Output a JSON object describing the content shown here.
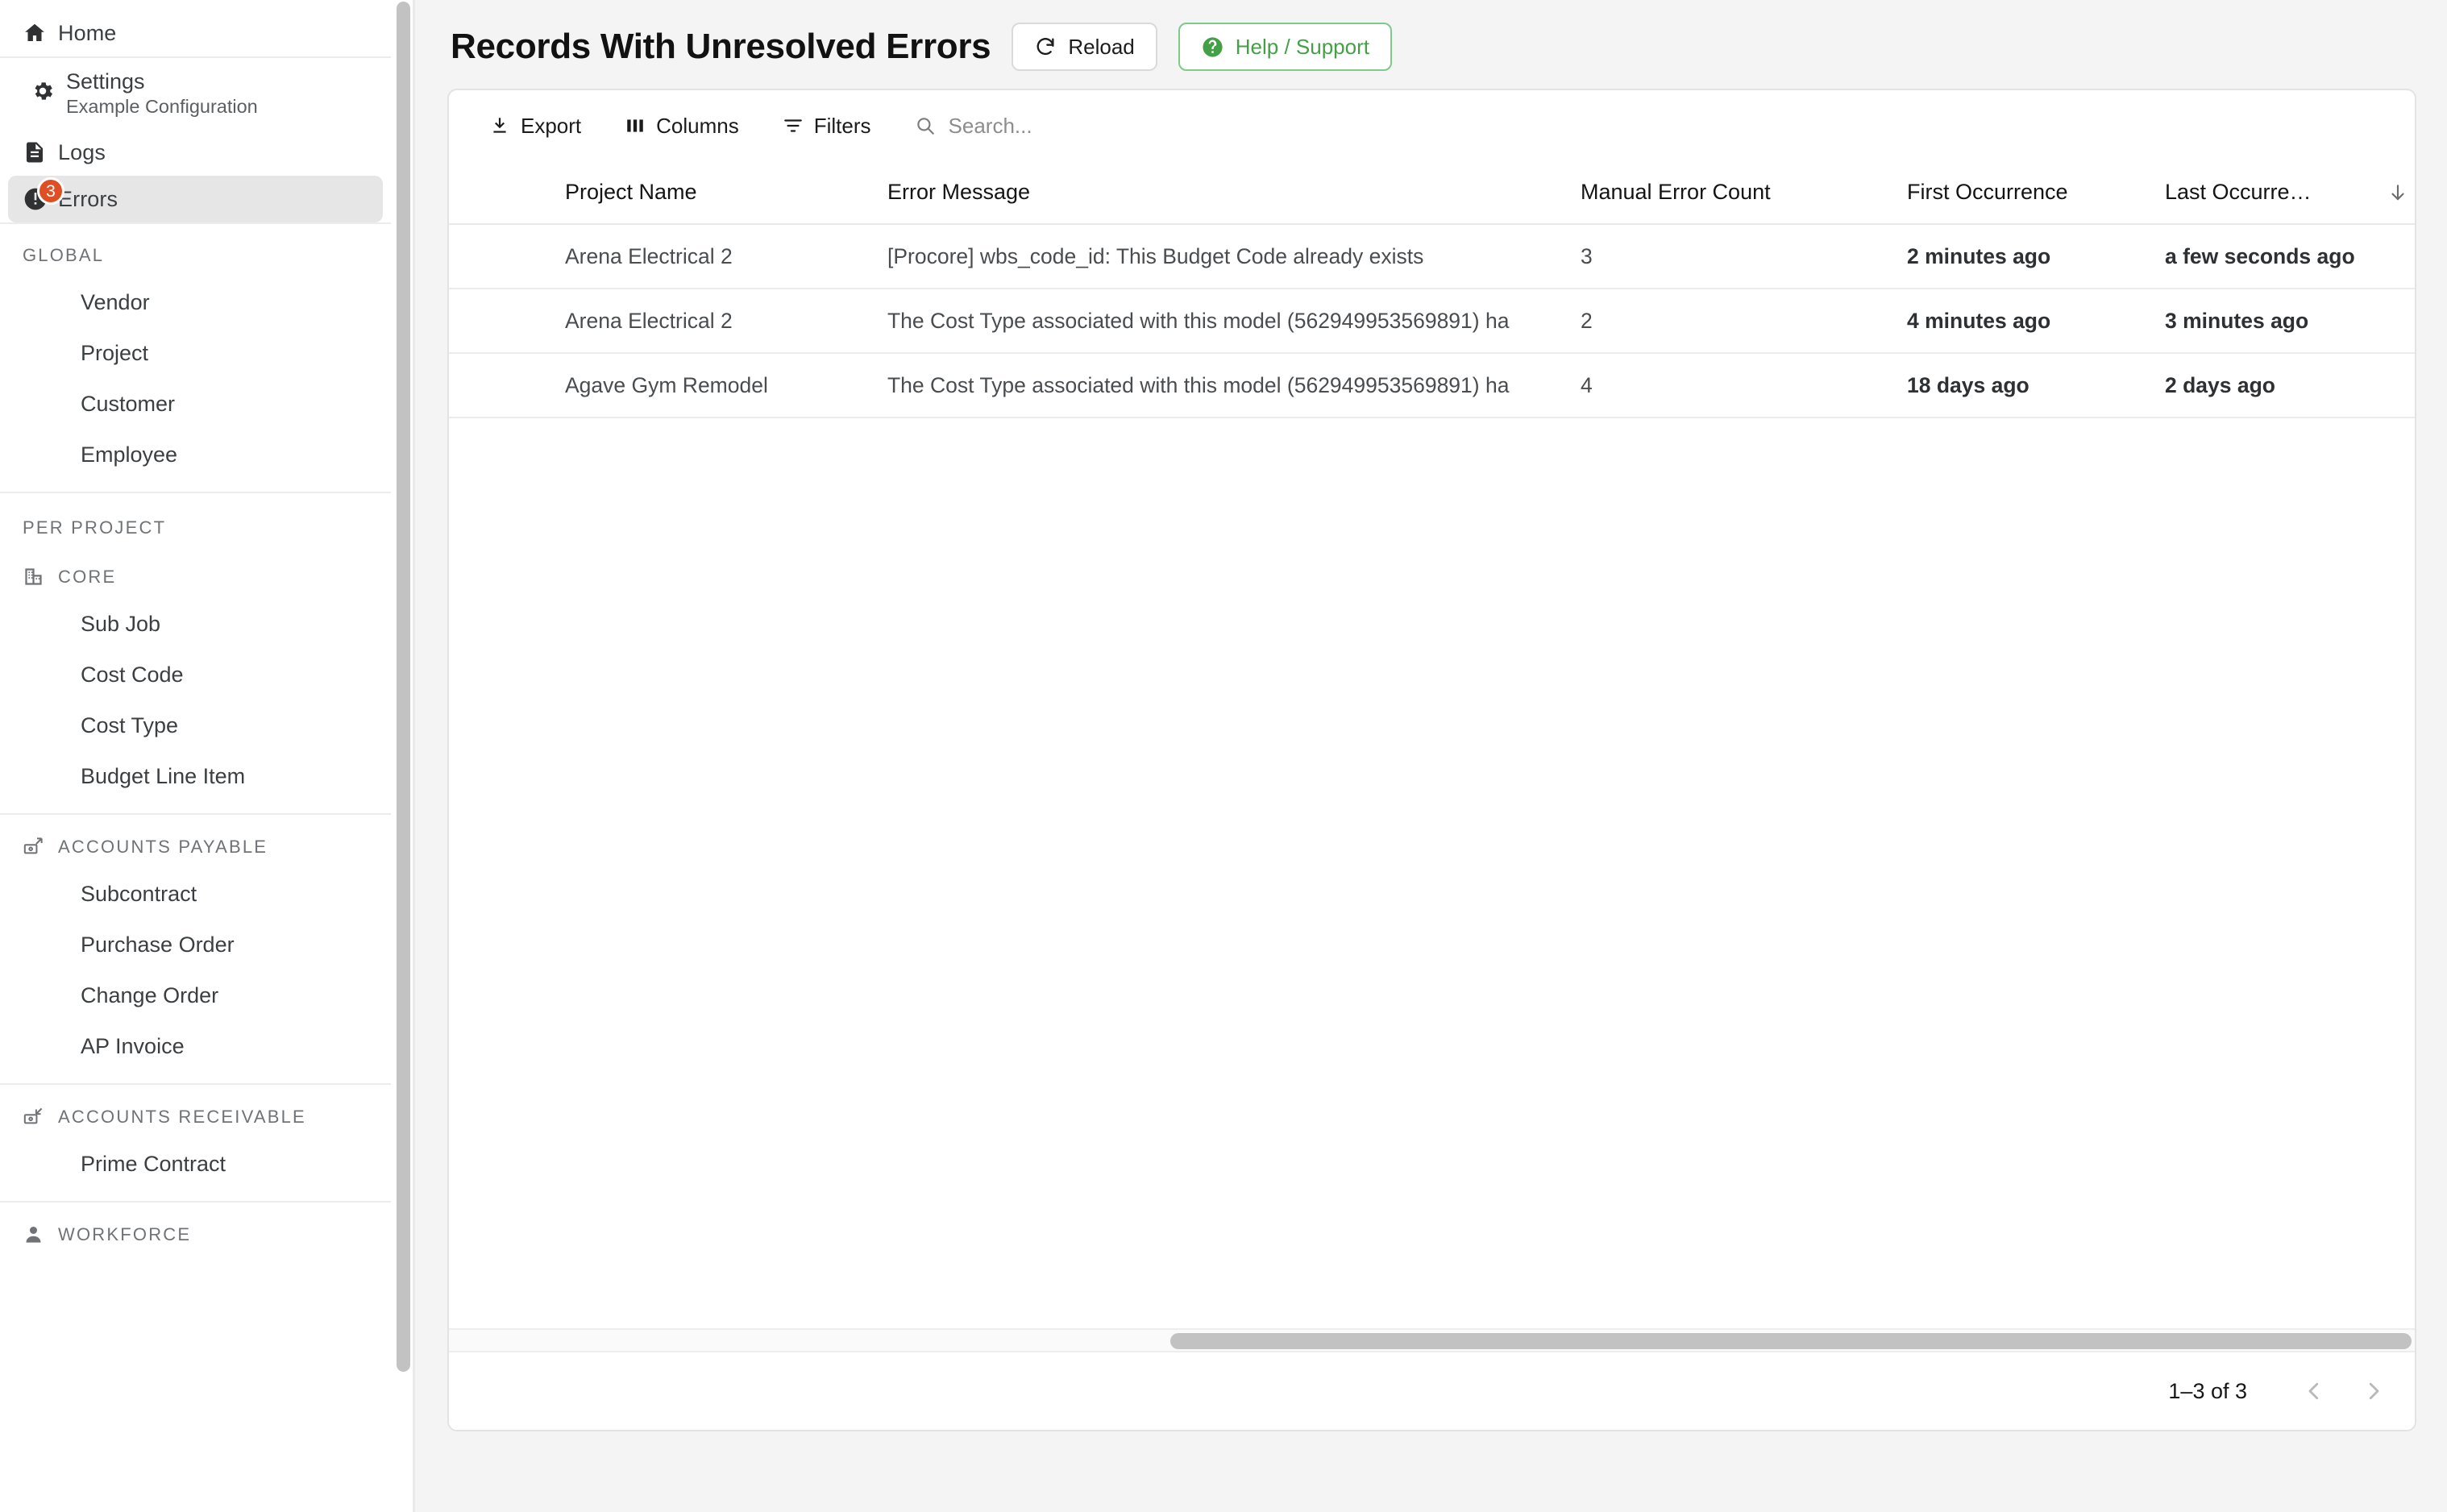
{
  "sidebar": {
    "home": {
      "label": "Home",
      "icon": "home-icon"
    },
    "settings": {
      "label": "Settings",
      "sublabel": "Example Configuration",
      "icon": "gear-icon"
    },
    "logs": {
      "label": "Logs",
      "icon": "document-icon"
    },
    "errors": {
      "label": "Errors",
      "icon": "error-clock-icon",
      "badge": "3"
    },
    "groups": [
      {
        "title": "GLOBAL",
        "icon": null,
        "items": [
          "Vendor",
          "Project",
          "Customer",
          "Employee"
        ]
      },
      {
        "title": "PER PROJECT",
        "icon": null,
        "items": []
      },
      {
        "title": "CORE",
        "icon": "building-icon",
        "items": [
          "Sub Job",
          "Cost Code",
          "Cost Type",
          "Budget Line Item"
        ]
      },
      {
        "title": "ACCOUNTS PAYABLE",
        "icon": "money-out-icon",
        "items": [
          "Subcontract",
          "Purchase Order",
          "Change Order",
          "AP Invoice"
        ]
      },
      {
        "title": "ACCOUNTS RECEIVABLE",
        "icon": "money-in-icon",
        "items": [
          "Prime Contract"
        ]
      },
      {
        "title": "WORKFORCE",
        "icon": "person-icon",
        "items": []
      }
    ]
  },
  "header": {
    "title": "Records With Unresolved Errors",
    "reload_label": "Reload",
    "reload_icon": "refresh-icon",
    "help_label": "Help / Support",
    "help_icon": "question-circle-icon",
    "help_color": "#43a047"
  },
  "toolbar": {
    "export_label": "Export",
    "export_icon": "download-icon",
    "columns_label": "Columns",
    "columns_icon": "columns-icon",
    "filters_label": "Filters",
    "filters_icon": "filter-icon",
    "search_icon": "search-icon",
    "search_placeholder": "Search...",
    "search_value": ""
  },
  "table": {
    "columns": [
      {
        "key": "project_name",
        "label": "Project Name"
      },
      {
        "key": "error_message",
        "label": "Error Message"
      },
      {
        "key": "manual_error_count",
        "label": "Manual Error Count"
      },
      {
        "key": "first_occurrence",
        "label": "First Occurrence"
      },
      {
        "key": "last_occurrence",
        "label": "Last Occurre…"
      }
    ],
    "sorted_column": "Last Occurre…",
    "sort_direction": "desc",
    "sort_icon": "arrow-down-icon",
    "rows": [
      {
        "project_name": "Arena Electrical 2",
        "error_message": "[Procore] wbs_code_id: This Budget Code already exists",
        "manual_error_count": "3",
        "first_occurrence": "2 minutes ago",
        "last_occurrence": "a few seconds ago"
      },
      {
        "project_name": "Arena Electrical 2",
        "error_message": "The Cost Type associated with this model (562949953569891) ha",
        "manual_error_count": "2",
        "first_occurrence": "4 minutes ago",
        "last_occurrence": "3 minutes ago"
      },
      {
        "project_name": "Agave Gym Remodel",
        "error_message": "The Cost Type associated with this model (562949953569891) ha",
        "manual_error_count": "4",
        "first_occurrence": "18 days ago",
        "last_occurrence": "2 days ago"
      }
    ]
  },
  "pagination": {
    "range_label": "1–3 of 3",
    "prev_icon": "chevron-left-icon",
    "next_icon": "chevron-right-icon"
  }
}
